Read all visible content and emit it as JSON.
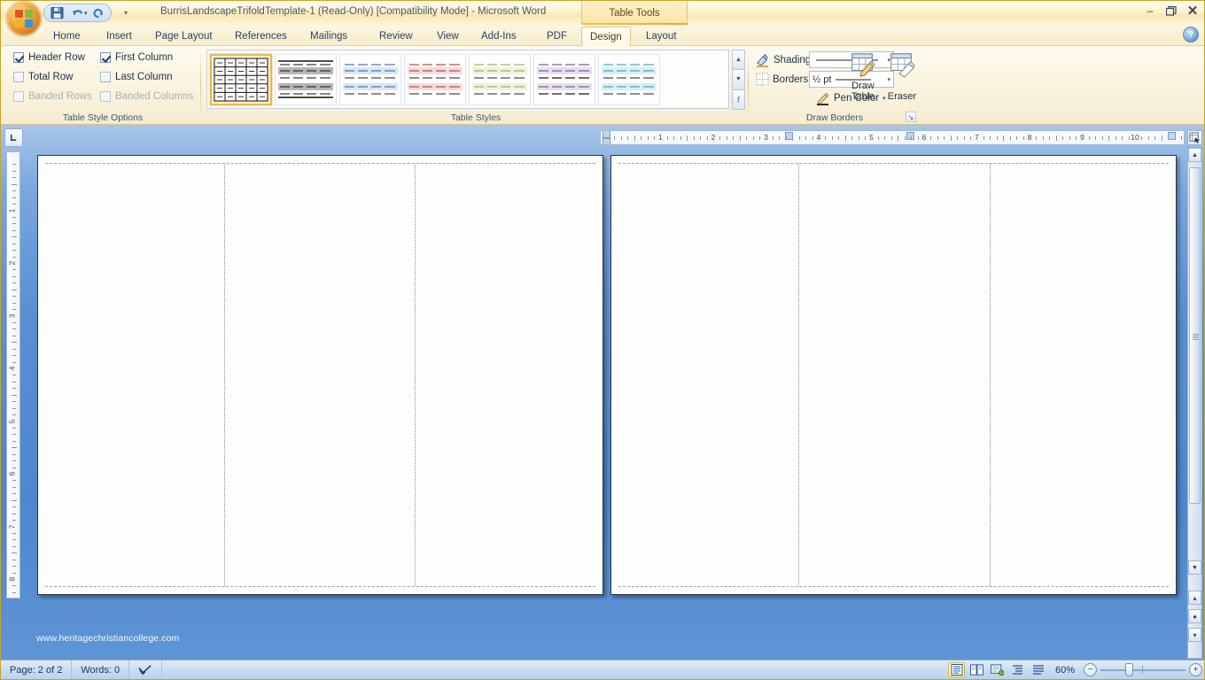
{
  "window": {
    "title": "BurrisLandscapeTrifoldTemplate-1 (Read-Only) [Compatibility Mode] - Microsoft Word",
    "contextual_tab_label": "Table Tools",
    "minimize_label": "–",
    "restore_label": "❐",
    "close_label": "✕",
    "help_label": "?"
  },
  "quick_access": {
    "save_label": "💾",
    "undo_label": "↶",
    "redo_label": "↻",
    "customize_label": "▾"
  },
  "tabs": [
    {
      "label": "Home",
      "active": false
    },
    {
      "label": "Insert",
      "active": false
    },
    {
      "label": "Page Layout",
      "active": false
    },
    {
      "label": "References",
      "active": false
    },
    {
      "label": "Mailings",
      "active": false
    },
    {
      "label": "Review",
      "active": false
    },
    {
      "label": "View",
      "active": false
    },
    {
      "label": "Add-Ins",
      "active": false
    },
    {
      "label": "PDF",
      "active": false
    },
    {
      "label": "Design",
      "active": true
    },
    {
      "label": "Layout",
      "active": false
    }
  ],
  "ribbon": {
    "table_style_options": {
      "group_label": "Table Style Options",
      "checkboxes": [
        {
          "label": "Header Row",
          "checked": true,
          "disabled": false
        },
        {
          "label": "First Column",
          "checked": true,
          "disabled": false
        },
        {
          "label": "Total Row",
          "checked": false,
          "disabled": false
        },
        {
          "label": "Last Column",
          "checked": false,
          "disabled": false
        },
        {
          "label": "Banded Rows",
          "checked": false,
          "disabled": true
        },
        {
          "label": "Banded Columns",
          "checked": false,
          "disabled": true
        }
      ]
    },
    "table_styles": {
      "group_label": "Table Styles",
      "swatches": [
        {
          "name": "table-grid",
          "accent": "#000000",
          "band": "#ffffff",
          "selected": true
        },
        {
          "name": "light-shading-gray",
          "accent": "#222222",
          "band": "#b3b3b3",
          "selected": false
        },
        {
          "name": "light-list-blue",
          "accent": "#4a7ebb",
          "band": "#dce6f2",
          "selected": false
        },
        {
          "name": "light-list-red",
          "accent": "#c0504d",
          "band": "#f2dcdb",
          "selected": false
        },
        {
          "name": "light-list-olive",
          "accent": "#9bbb59",
          "band": "#ebf1de",
          "selected": false
        },
        {
          "name": "light-list-purple",
          "accent": "#8064a2",
          "band": "#e5dfec",
          "selected": false
        },
        {
          "name": "light-list-aqua",
          "accent": "#4bacc6",
          "band": "#daeef3",
          "selected": false
        }
      ],
      "scroll_up_label": "▲",
      "scroll_down_label": "▼",
      "more_label": "⨍"
    },
    "draw_borders": {
      "group_label": "Draw Borders",
      "shading_label": "Shading",
      "borders_label": "Borders",
      "line_style_value": "",
      "line_weight_value": "½ pt",
      "pen_color_label": "Pen Color",
      "draw_table_label_1": "Draw",
      "draw_table_label_2": "Table",
      "eraser_label": "Eraser",
      "dialog_launcher_label": "↘"
    }
  },
  "ruler": {
    "horizontal_numbers": [
      "1",
      "2",
      "3",
      "4",
      "5",
      "6",
      "7",
      "8",
      "9",
      "10"
    ],
    "vertical_numbers": [
      "1",
      "2",
      "3",
      "4",
      "5",
      "6",
      "7",
      "8"
    ],
    "tab_selector_label": "└"
  },
  "document": {
    "watermark_text": "www.heritagechristiancollege.com",
    "pages": [
      {
        "name": "page-left",
        "columns": 3
      },
      {
        "name": "page-right",
        "columns": 3
      }
    ]
  },
  "status_bar": {
    "page_label": "Page: 2 of 2",
    "words_label": "Words: 0",
    "proofing_icon": "✔",
    "zoom_label": "60%",
    "zoom_out_label": "−",
    "zoom_in_label": "+",
    "view_buttons": [
      {
        "name": "print-layout",
        "glyph": "☰",
        "active": true
      },
      {
        "name": "full-screen-reading",
        "glyph": "◫",
        "active": false
      },
      {
        "name": "web-layout",
        "glyph": "▤",
        "active": false
      },
      {
        "name": "outline",
        "glyph": "≣",
        "active": false
      },
      {
        "name": "draft",
        "glyph": "≡",
        "active": false
      }
    ]
  },
  "scrollbar": {
    "up_label": "▲",
    "down_label": "▼",
    "prev_page_label": "▴",
    "select_browse_label": "●",
    "next_page_label": "▾",
    "select_browse_object_label": "❐"
  }
}
